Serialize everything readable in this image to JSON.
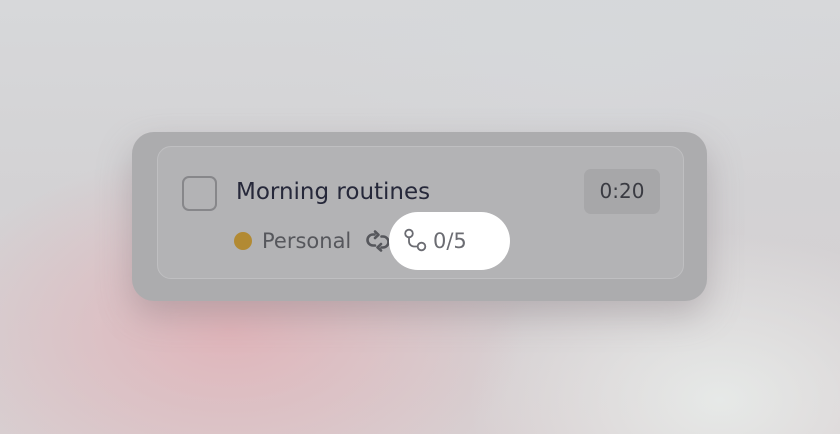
{
  "task": {
    "title": "Morning routines",
    "duration": "0:20",
    "completed": false,
    "tag": {
      "label": "Personal",
      "color": "#b28a33"
    },
    "repeat_icon": "repeat-icon",
    "subtasks": {
      "icon": "subtasks-icon",
      "progress": "0/5"
    }
  }
}
